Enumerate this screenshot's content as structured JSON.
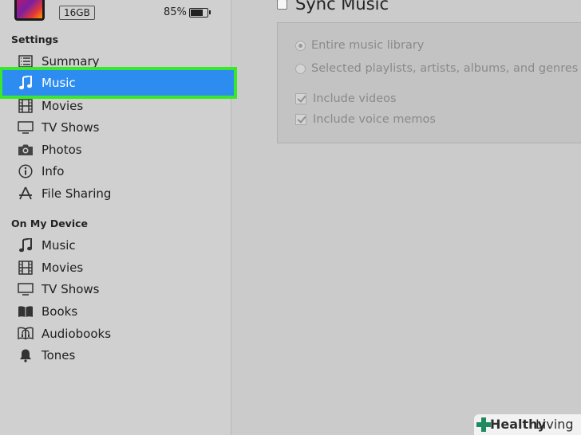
{
  "device": {
    "capacity": "16GB",
    "battery_percent": "85%",
    "battery_level": 0.85
  },
  "sidebar": {
    "settings_title": "Settings",
    "settings_items": [
      {
        "label": "Summary",
        "icon": "summary-icon"
      },
      {
        "label": "Music",
        "icon": "music-note-icon",
        "selected": true
      },
      {
        "label": "Movies",
        "icon": "film-icon"
      },
      {
        "label": "TV Shows",
        "icon": "tv-icon"
      },
      {
        "label": "Photos",
        "icon": "camera-icon"
      },
      {
        "label": "Info",
        "icon": "info-icon"
      },
      {
        "label": "File Sharing",
        "icon": "app-store-icon"
      }
    ],
    "device_title": "On My Device",
    "device_items": [
      {
        "label": "Music",
        "icon": "music-note-icon"
      },
      {
        "label": "Movies",
        "icon": "film-icon"
      },
      {
        "label": "TV Shows",
        "icon": "tv-icon"
      },
      {
        "label": "Books",
        "icon": "book-icon"
      },
      {
        "label": "Audiobooks",
        "icon": "audiobook-icon"
      },
      {
        "label": "Tones",
        "icon": "bell-icon"
      }
    ]
  },
  "main": {
    "sync_label": "Sync Music",
    "sync_checked": false,
    "options": {
      "entire_library": "Entire music library",
      "selected": "Selected playlists, artists, albums, and genres",
      "include_videos": "Include videos",
      "include_voice_memos": "Include voice memos"
    }
  },
  "watermark": {
    "brand_bold": "Healthy",
    "brand_light": "Living"
  },
  "colors": {
    "selection": "#2d8cf0",
    "highlight_outline": "#38e82a",
    "watermark_cross": "#1f8a5f"
  }
}
